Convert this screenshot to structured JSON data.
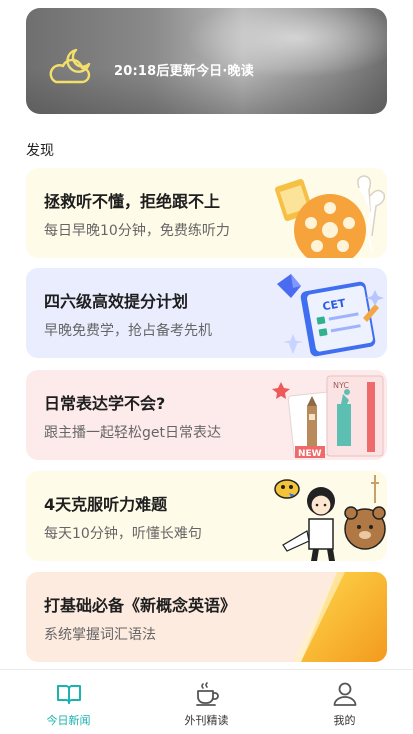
{
  "hero": {
    "text": "20:18后更新今日·晚读",
    "icon": "moon-cloud-icon"
  },
  "section": {
    "title": "发现"
  },
  "cards": [
    {
      "title": "拯救听不懂，拒绝跟不上",
      "subtitle": "每日早晚10分钟，免费练听力",
      "icon": "film-earphones-illustration"
    },
    {
      "title": "四六级高效提分计划",
      "subtitle": "早晚免费学，抢占备考先机",
      "icon": "cet-book-illustration",
      "badge": "CET"
    },
    {
      "title": "日常表达学不会?",
      "subtitle": "跟主播一起轻松get日常表达",
      "icon": "travel-tickets-illustration",
      "badge": "NEW",
      "ticket_text": "NYC"
    },
    {
      "title": "4天克服听力难题",
      "subtitle": "每天10分钟，听懂长难句",
      "icon": "cartoon-girl-bear-illustration"
    },
    {
      "title": "打基础必备《新概念英语》",
      "subtitle": "系统掌握词汇语法",
      "icon": "orange-book-illustration"
    }
  ],
  "tabs": [
    {
      "label": "今日新闻",
      "icon": "open-book-icon",
      "active": true
    },
    {
      "label": "外刊精读",
      "icon": "coffee-cup-icon",
      "active": false
    },
    {
      "label": "我的",
      "icon": "user-icon",
      "active": false
    }
  ],
  "colors": {
    "accent": "#19b3b0",
    "card1": "#fffbe9",
    "card2": "#e9edfd",
    "card3": "#fdeaea",
    "card4": "#fffbe9",
    "card5": "#fdebe0"
  }
}
